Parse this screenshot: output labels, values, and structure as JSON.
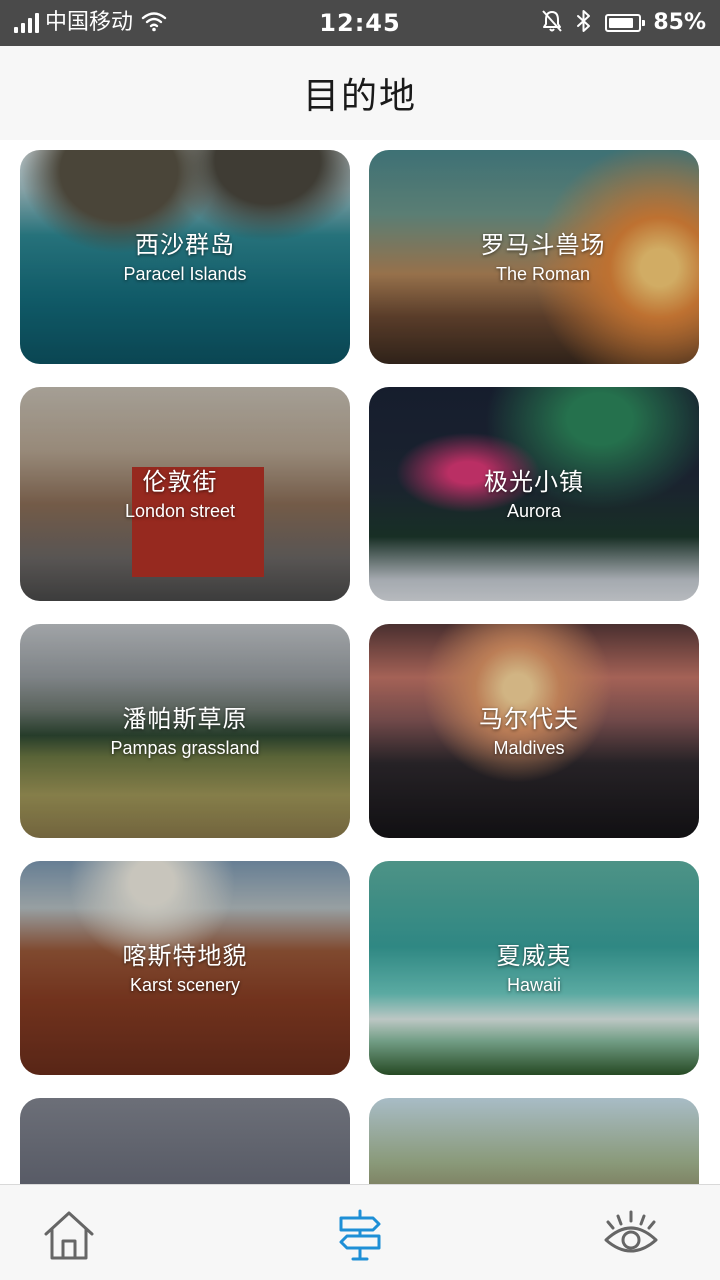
{
  "status_bar": {
    "carrier": "中国移动",
    "time": "12:45",
    "battery_percent": "85%",
    "battery_level": 0.85
  },
  "header": {
    "title": "目的地"
  },
  "destinations": [
    {
      "cn": "西沙群岛",
      "en": "Paracel Islands"
    },
    {
      "cn": "罗马斗兽场",
      "en": "The Roman"
    },
    {
      "cn": "伦敦街",
      "en": "London street"
    },
    {
      "cn": "极光小镇",
      "en": "Aurora"
    },
    {
      "cn": "潘帕斯草原",
      "en": "Pampas grassland"
    },
    {
      "cn": "马尔代夫",
      "en": "Maldives"
    },
    {
      "cn": "喀斯特地貌",
      "en": "Karst scenery"
    },
    {
      "cn": "夏威夷",
      "en": "Hawaii"
    }
  ],
  "tab_bar": {
    "items": [
      {
        "icon": "home-icon",
        "active": false
      },
      {
        "icon": "signpost-icon",
        "active": true
      },
      {
        "icon": "eye-icon",
        "active": false
      }
    ],
    "active_color": "#1e8fd6",
    "inactive_color": "#666666"
  }
}
